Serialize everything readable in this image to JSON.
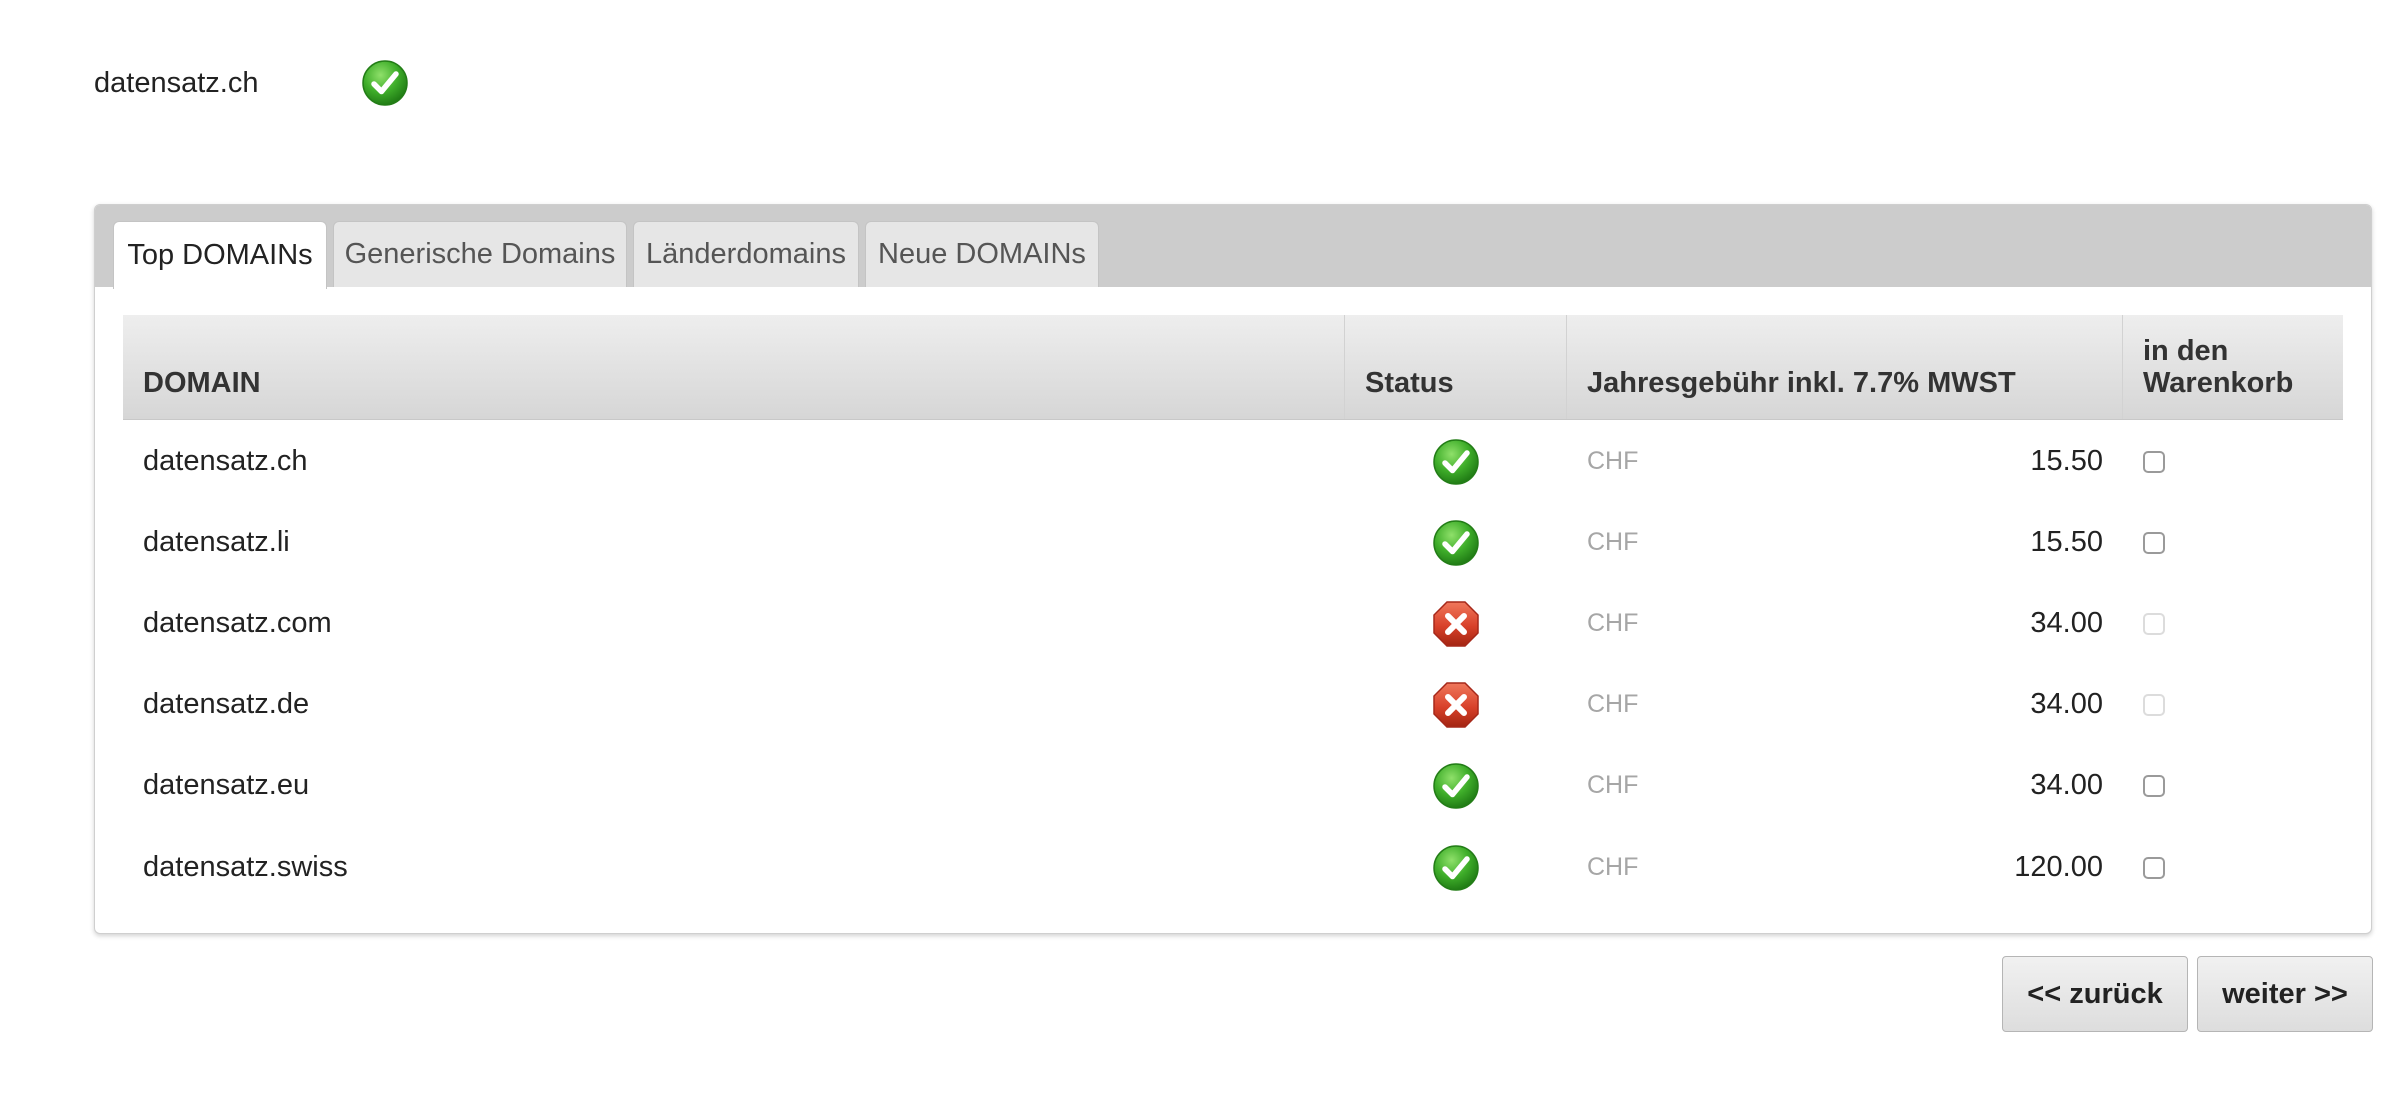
{
  "search_result": {
    "domain": "datensatz.ch",
    "status_icon": "check-circle-icon"
  },
  "tabs": [
    {
      "label": "Top DOMAINs",
      "active": true
    },
    {
      "label": "Generische Domains",
      "active": false
    },
    {
      "label": "Länderdomains",
      "active": false
    },
    {
      "label": "Neue DOMAINs",
      "active": false
    }
  ],
  "table": {
    "columns": {
      "domain": "DOMAIN",
      "status": "Status",
      "fee": "Jahresgebühr inkl. 7.7% MWST",
      "cart": "in den Warenkorb"
    },
    "rows": [
      {
        "domain": "datensatz.ch",
        "status": "available",
        "status_icon": "check-circle-icon",
        "currency": "CHF",
        "price": "15.50"
      },
      {
        "domain": "datensatz.li",
        "status": "available",
        "status_icon": "check-circle-icon",
        "currency": "CHF",
        "price": "15.50"
      },
      {
        "domain": "datensatz.com",
        "status": "taken",
        "status_icon": "x-octagon-icon",
        "currency": "CHF",
        "price": "34.00"
      },
      {
        "domain": "datensatz.de",
        "status": "taken",
        "status_icon": "x-octagon-icon",
        "currency": "CHF",
        "price": "34.00"
      },
      {
        "domain": "datensatz.eu",
        "status": "available",
        "status_icon": "check-circle-icon",
        "currency": "CHF",
        "price": "34.00"
      },
      {
        "domain": "datensatz.swiss",
        "status": "available",
        "status_icon": "check-circle-icon",
        "currency": "CHF",
        "price": "120.00"
      }
    ]
  },
  "buttons": {
    "back": "<< zurück",
    "next": "weiter >>"
  },
  "colors": {
    "available": "#3fae2a",
    "taken": "#d8412a",
    "tabbar": "#cccccc"
  }
}
